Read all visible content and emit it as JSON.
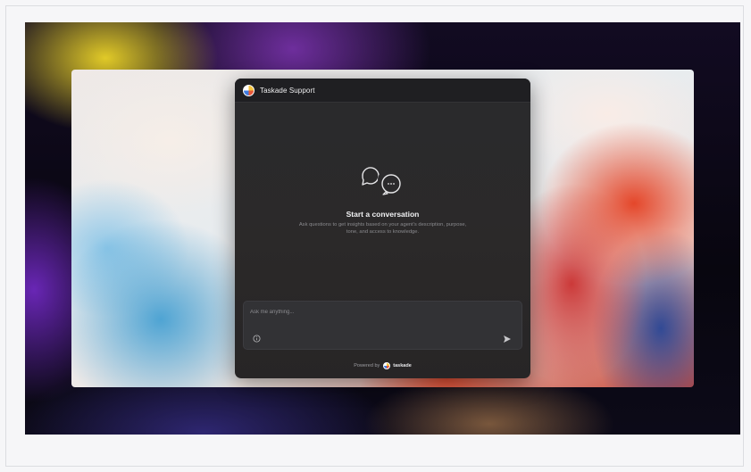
{
  "widget": {
    "agent_name": "Taskade Support",
    "empty_state": {
      "title": "Start a conversation",
      "description": "Ask questions to get insights based on your agent's description, purpose, tone, and access to knowledge."
    },
    "composer": {
      "placeholder": "Ask me anything...",
      "value": ""
    },
    "footer": {
      "powered_by": "Powered by",
      "brand": "taskade"
    }
  },
  "icons": {
    "header": "agent-avatar",
    "empty_state": "chat-bubbles-icon",
    "composer_left": "info-icon",
    "composer_right": "send-icon",
    "footer": "taskade-logo-icon"
  },
  "colors": {
    "widget_bg": "#2a2a2d",
    "header_bg": "#1f1f22",
    "composer_bg": "#323235",
    "text_primary": "#f2f2f4",
    "text_secondary": "#8a8a8e"
  }
}
